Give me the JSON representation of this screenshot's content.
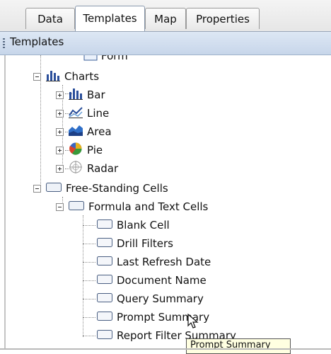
{
  "tabs": [
    {
      "label": "Data",
      "active": false
    },
    {
      "label": "Templates",
      "active": true
    },
    {
      "label": "Map",
      "active": false
    },
    {
      "label": "Properties",
      "active": false
    }
  ],
  "panel": {
    "title": "Templates"
  },
  "tree": {
    "form": "Form",
    "charts": {
      "label": "Charts",
      "items": [
        "Bar",
        "Line",
        "Area",
        "Pie",
        "Radar"
      ]
    },
    "free_standing": {
      "label": "Free-Standing Cells",
      "formula": {
        "label": "Formula and Text Cells",
        "items": [
          "Blank Cell",
          "Drill Filters",
          "Last Refresh Date",
          "Document Name",
          "Query Summary",
          "Prompt Summary",
          "Report Filter Summary"
        ]
      }
    }
  },
  "tooltip": "Prompt Summary"
}
